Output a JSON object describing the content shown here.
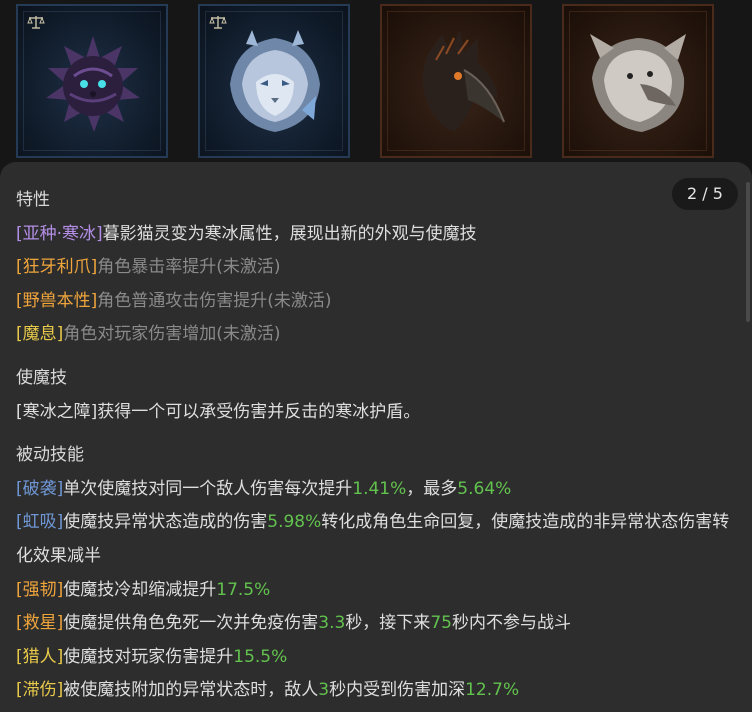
{
  "cards": [
    {
      "icon": "scale-icon",
      "portrait": "dark-hedgehog-portrait",
      "theme": "blue"
    },
    {
      "icon": "scale-icon",
      "portrait": "ice-lion-portrait",
      "theme": "blue"
    },
    {
      "icon": "",
      "portrait": "dark-bird-portrait",
      "theme": "orange"
    },
    {
      "icon": "",
      "portrait": "white-beast-portrait",
      "theme": "orange"
    }
  ],
  "pager": "2 / 5",
  "traits": {
    "heading": "特性",
    "items": [
      {
        "tag": "[亚种·寒冰]",
        "desc": "暮影猫灵变为寒冰属性，展现出新的外观与使魔技"
      },
      {
        "tag": "[狂牙利爪]",
        "desc": "角色暴击率提升(未激活)"
      },
      {
        "tag": "[野兽本性]",
        "desc": "角色普通攻击伤害提升(未激活)"
      },
      {
        "tag": "[魔息]",
        "desc": "角色对玩家伤害增加(未激活)"
      }
    ]
  },
  "skill": {
    "heading": "使魔技",
    "text": "[寒冰之障]获得一个可以承受伤害并反击的寒冰护盾。"
  },
  "passives": {
    "heading": "被动技能",
    "p1": {
      "tag": "[破袭]",
      "a": "单次使魔技对同一个敌人伤害每次提升",
      "v1": "1.41%",
      "b": "，最多",
      "v2": "5.64%"
    },
    "p2": {
      "tag": "[虹吸]",
      "a": "使魔技异常状态造成的伤害",
      "v1": "5.98%",
      "b": "转化成角色生命回复，使魔技造成的非异常状态伤害转化效果减半"
    },
    "p3": {
      "tag": "[强韧]",
      "a": "使魔技冷却缩减提升",
      "v1": "17.5%"
    },
    "p4": {
      "tag": "[救星]",
      "a": "使魔提供角色免死一次并免疫伤害",
      "v1": "3.3",
      "b": "秒，接下来",
      "v2": "75",
      "c": "秒内不参与战斗"
    },
    "p5": {
      "tag": "[猎人]",
      "a": "使魔技对玩家伤害提升",
      "v1": "15.5%"
    },
    "p6": {
      "tag": "[滞伤]",
      "a": "被使魔技附加的异常状态时，敌人",
      "v1": "3",
      "b": "秒内受到伤害加深",
      "v2": "12.7%"
    }
  },
  "colors": {
    "purple_tag": "#b48ee6",
    "orange_tag": "#f0a53c",
    "gold_tag": "#e8c94a",
    "blue_tag": "#6f97d6",
    "value_green": "#62c24e",
    "inactive_gray": "#8a8a8a"
  }
}
